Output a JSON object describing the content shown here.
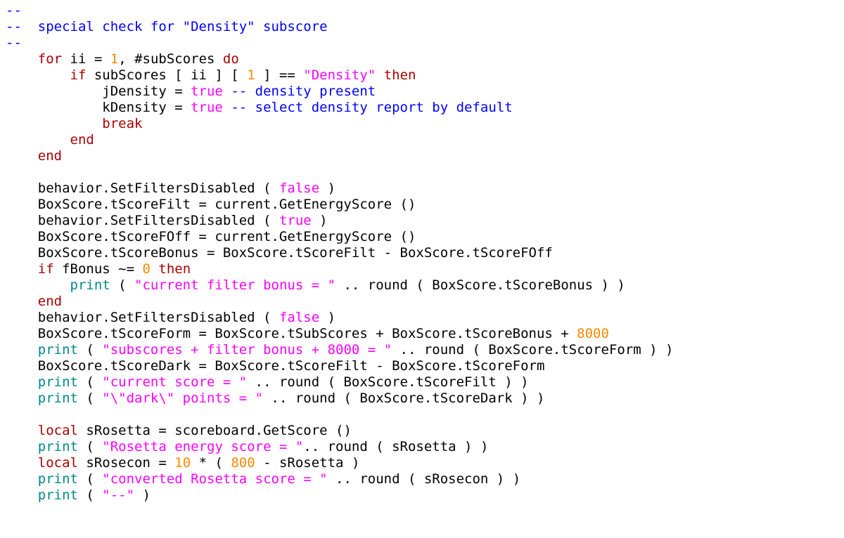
{
  "code": {
    "lines": [
      [
        {
          "t": "--",
          "c": "comment"
        }
      ],
      [
        {
          "t": "--  special check for \"Density\" subscore",
          "c": "comment"
        }
      ],
      [
        {
          "t": "--",
          "c": "comment"
        }
      ],
      [
        {
          "t": "    ",
          "c": ""
        },
        {
          "t": "for",
          "c": "keyword"
        },
        {
          "t": " ii = ",
          "c": ""
        },
        {
          "t": "1",
          "c": "number"
        },
        {
          "t": ", #subScores ",
          "c": ""
        },
        {
          "t": "do",
          "c": "keyword"
        }
      ],
      [
        {
          "t": "        ",
          "c": ""
        },
        {
          "t": "if",
          "c": "keyword"
        },
        {
          "t": " subScores [ ii ] [ ",
          "c": ""
        },
        {
          "t": "1",
          "c": "number"
        },
        {
          "t": " ] == ",
          "c": ""
        },
        {
          "t": "\"Density\"",
          "c": "string"
        },
        {
          "t": " ",
          "c": ""
        },
        {
          "t": "then",
          "c": "keyword"
        }
      ],
      [
        {
          "t": "            jDensity = ",
          "c": ""
        },
        {
          "t": "true",
          "c": "literal"
        },
        {
          "t": " ",
          "c": ""
        },
        {
          "t": "-- density present",
          "c": "comment"
        }
      ],
      [
        {
          "t": "            kDensity = ",
          "c": ""
        },
        {
          "t": "true",
          "c": "literal"
        },
        {
          "t": " ",
          "c": ""
        },
        {
          "t": "-- select density report by default",
          "c": "comment"
        }
      ],
      [
        {
          "t": "            ",
          "c": ""
        },
        {
          "t": "break",
          "c": "keyword"
        }
      ],
      [
        {
          "t": "        ",
          "c": ""
        },
        {
          "t": "end",
          "c": "keyword"
        }
      ],
      [
        {
          "t": "    ",
          "c": ""
        },
        {
          "t": "end",
          "c": "keyword"
        }
      ],
      [
        {
          "t": " ",
          "c": ""
        }
      ],
      [
        {
          "t": "    behavior.SetFiltersDisabled ( ",
          "c": ""
        },
        {
          "t": "false",
          "c": "literal"
        },
        {
          "t": " )",
          "c": ""
        }
      ],
      [
        {
          "t": "    BoxScore.tScoreFilt = current.GetEnergyScore ()",
          "c": ""
        }
      ],
      [
        {
          "t": "    behavior.SetFiltersDisabled ( ",
          "c": ""
        },
        {
          "t": "true",
          "c": "literal"
        },
        {
          "t": " )",
          "c": ""
        }
      ],
      [
        {
          "t": "    BoxScore.tScoreFOff = current.GetEnergyScore ()",
          "c": ""
        }
      ],
      [
        {
          "t": "    BoxScore.tScoreBonus = BoxScore.tScoreFilt - BoxScore.tScoreFOff",
          "c": ""
        }
      ],
      [
        {
          "t": "    ",
          "c": ""
        },
        {
          "t": "if",
          "c": "keyword"
        },
        {
          "t": " fBonus ~= ",
          "c": ""
        },
        {
          "t": "0",
          "c": "number"
        },
        {
          "t": " ",
          "c": ""
        },
        {
          "t": "then",
          "c": "keyword"
        }
      ],
      [
        {
          "t": "        ",
          "c": ""
        },
        {
          "t": "print",
          "c": "func"
        },
        {
          "t": " ( ",
          "c": ""
        },
        {
          "t": "\"current filter bonus = \"",
          "c": "string"
        },
        {
          "t": " .. round ( BoxScore.tScoreBonus ) )",
          "c": ""
        }
      ],
      [
        {
          "t": "    ",
          "c": ""
        },
        {
          "t": "end",
          "c": "keyword"
        }
      ],
      [
        {
          "t": "    behavior.SetFiltersDisabled ( ",
          "c": ""
        },
        {
          "t": "false",
          "c": "literal"
        },
        {
          "t": " )",
          "c": ""
        }
      ],
      [
        {
          "t": "    BoxScore.tScoreForm = BoxScore.tSubScores + BoxScore.tScoreBonus + ",
          "c": ""
        },
        {
          "t": "8000",
          "c": "number"
        }
      ],
      [
        {
          "t": "    ",
          "c": ""
        },
        {
          "t": "print",
          "c": "func"
        },
        {
          "t": " ( ",
          "c": ""
        },
        {
          "t": "\"subscores + filter bonus + 8000 = \"",
          "c": "string"
        },
        {
          "t": " .. round ( BoxScore.tScoreForm ) )",
          "c": ""
        }
      ],
      [
        {
          "t": "    BoxScore.tScoreDark = BoxScore.tScoreFilt - BoxScore.tScoreForm",
          "c": ""
        }
      ],
      [
        {
          "t": "    ",
          "c": ""
        },
        {
          "t": "print",
          "c": "func"
        },
        {
          "t": " ( ",
          "c": ""
        },
        {
          "t": "\"current score = \"",
          "c": "string"
        },
        {
          "t": " .. round ( BoxScore.tScoreFilt ) )",
          "c": ""
        }
      ],
      [
        {
          "t": "    ",
          "c": ""
        },
        {
          "t": "print",
          "c": "func"
        },
        {
          "t": " ( ",
          "c": ""
        },
        {
          "t": "\"\\\"dark\\\" points = \"",
          "c": "string"
        },
        {
          "t": " .. round ( BoxScore.tScoreDark ) )",
          "c": ""
        }
      ],
      [
        {
          "t": " ",
          "c": ""
        }
      ],
      [
        {
          "t": "    ",
          "c": ""
        },
        {
          "t": "local",
          "c": "keyword"
        },
        {
          "t": " sRosetta = scoreboard.GetScore ()",
          "c": ""
        }
      ],
      [
        {
          "t": "    ",
          "c": ""
        },
        {
          "t": "print",
          "c": "func"
        },
        {
          "t": " ( ",
          "c": ""
        },
        {
          "t": "\"Rosetta energy score = \"",
          "c": "string"
        },
        {
          "t": ".. round ( sRosetta ) )",
          "c": ""
        }
      ],
      [
        {
          "t": "    ",
          "c": ""
        },
        {
          "t": "local",
          "c": "keyword"
        },
        {
          "t": " sRosecon = ",
          "c": ""
        },
        {
          "t": "10",
          "c": "number"
        },
        {
          "t": " * ( ",
          "c": ""
        },
        {
          "t": "800",
          "c": "number"
        },
        {
          "t": " - sRosetta )",
          "c": ""
        }
      ],
      [
        {
          "t": "    ",
          "c": ""
        },
        {
          "t": "print",
          "c": "func"
        },
        {
          "t": " ( ",
          "c": ""
        },
        {
          "t": "\"converted Rosetta score = \"",
          "c": "string"
        },
        {
          "t": " .. round ( sRosecon ) )",
          "c": ""
        }
      ],
      [
        {
          "t": "    ",
          "c": ""
        },
        {
          "t": "print",
          "c": "func"
        },
        {
          "t": " ( ",
          "c": ""
        },
        {
          "t": "\"--\"",
          "c": "string"
        },
        {
          "t": " )",
          "c": ""
        }
      ]
    ]
  }
}
